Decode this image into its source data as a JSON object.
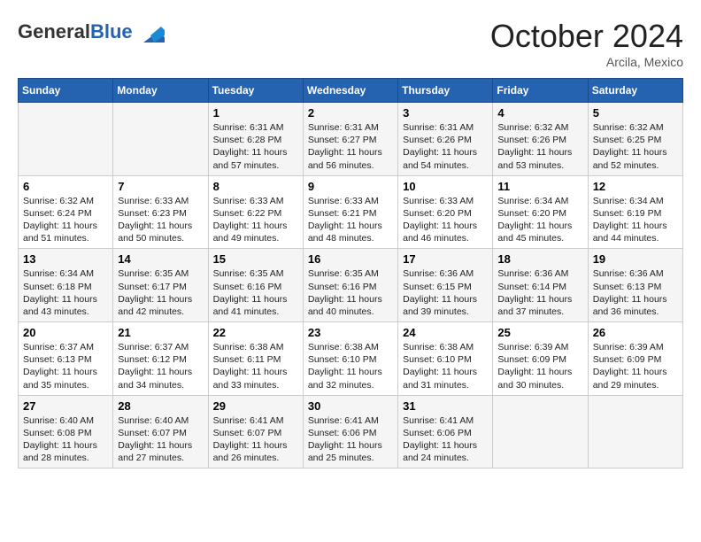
{
  "header": {
    "logo_general": "General",
    "logo_blue": "Blue",
    "month_title": "October 2024",
    "location": "Arcila, Mexico"
  },
  "weekdays": [
    "Sunday",
    "Monday",
    "Tuesday",
    "Wednesday",
    "Thursday",
    "Friday",
    "Saturday"
  ],
  "weeks": [
    [
      {
        "day": "",
        "info": ""
      },
      {
        "day": "",
        "info": ""
      },
      {
        "day": "1",
        "sunrise": "6:31 AM",
        "sunset": "6:28 PM",
        "daylight": "11 hours and 57 minutes."
      },
      {
        "day": "2",
        "sunrise": "6:31 AM",
        "sunset": "6:27 PM",
        "daylight": "11 hours and 56 minutes."
      },
      {
        "day": "3",
        "sunrise": "6:31 AM",
        "sunset": "6:26 PM",
        "daylight": "11 hours and 54 minutes."
      },
      {
        "day": "4",
        "sunrise": "6:32 AM",
        "sunset": "6:26 PM",
        "daylight": "11 hours and 53 minutes."
      },
      {
        "day": "5",
        "sunrise": "6:32 AM",
        "sunset": "6:25 PM",
        "daylight": "11 hours and 52 minutes."
      }
    ],
    [
      {
        "day": "6",
        "sunrise": "6:32 AM",
        "sunset": "6:24 PM",
        "daylight": "11 hours and 51 minutes."
      },
      {
        "day": "7",
        "sunrise": "6:33 AM",
        "sunset": "6:23 PM",
        "daylight": "11 hours and 50 minutes."
      },
      {
        "day": "8",
        "sunrise": "6:33 AM",
        "sunset": "6:22 PM",
        "daylight": "11 hours and 49 minutes."
      },
      {
        "day": "9",
        "sunrise": "6:33 AM",
        "sunset": "6:21 PM",
        "daylight": "11 hours and 48 minutes."
      },
      {
        "day": "10",
        "sunrise": "6:33 AM",
        "sunset": "6:20 PM",
        "daylight": "11 hours and 46 minutes."
      },
      {
        "day": "11",
        "sunrise": "6:34 AM",
        "sunset": "6:20 PM",
        "daylight": "11 hours and 45 minutes."
      },
      {
        "day": "12",
        "sunrise": "6:34 AM",
        "sunset": "6:19 PM",
        "daylight": "11 hours and 44 minutes."
      }
    ],
    [
      {
        "day": "13",
        "sunrise": "6:34 AM",
        "sunset": "6:18 PM",
        "daylight": "11 hours and 43 minutes."
      },
      {
        "day": "14",
        "sunrise": "6:35 AM",
        "sunset": "6:17 PM",
        "daylight": "11 hours and 42 minutes."
      },
      {
        "day": "15",
        "sunrise": "6:35 AM",
        "sunset": "6:16 PM",
        "daylight": "11 hours and 41 minutes."
      },
      {
        "day": "16",
        "sunrise": "6:35 AM",
        "sunset": "6:16 PM",
        "daylight": "11 hours and 40 minutes."
      },
      {
        "day": "17",
        "sunrise": "6:36 AM",
        "sunset": "6:15 PM",
        "daylight": "11 hours and 39 minutes."
      },
      {
        "day": "18",
        "sunrise": "6:36 AM",
        "sunset": "6:14 PM",
        "daylight": "11 hours and 37 minutes."
      },
      {
        "day": "19",
        "sunrise": "6:36 AM",
        "sunset": "6:13 PM",
        "daylight": "11 hours and 36 minutes."
      }
    ],
    [
      {
        "day": "20",
        "sunrise": "6:37 AM",
        "sunset": "6:13 PM",
        "daylight": "11 hours and 35 minutes."
      },
      {
        "day": "21",
        "sunrise": "6:37 AM",
        "sunset": "6:12 PM",
        "daylight": "11 hours and 34 minutes."
      },
      {
        "day": "22",
        "sunrise": "6:38 AM",
        "sunset": "6:11 PM",
        "daylight": "11 hours and 33 minutes."
      },
      {
        "day": "23",
        "sunrise": "6:38 AM",
        "sunset": "6:10 PM",
        "daylight": "11 hours and 32 minutes."
      },
      {
        "day": "24",
        "sunrise": "6:38 AM",
        "sunset": "6:10 PM",
        "daylight": "11 hours and 31 minutes."
      },
      {
        "day": "25",
        "sunrise": "6:39 AM",
        "sunset": "6:09 PM",
        "daylight": "11 hours and 30 minutes."
      },
      {
        "day": "26",
        "sunrise": "6:39 AM",
        "sunset": "6:09 PM",
        "daylight": "11 hours and 29 minutes."
      }
    ],
    [
      {
        "day": "27",
        "sunrise": "6:40 AM",
        "sunset": "6:08 PM",
        "daylight": "11 hours and 28 minutes."
      },
      {
        "day": "28",
        "sunrise": "6:40 AM",
        "sunset": "6:07 PM",
        "daylight": "11 hours and 27 minutes."
      },
      {
        "day": "29",
        "sunrise": "6:41 AM",
        "sunset": "6:07 PM",
        "daylight": "11 hours and 26 minutes."
      },
      {
        "day": "30",
        "sunrise": "6:41 AM",
        "sunset": "6:06 PM",
        "daylight": "11 hours and 25 minutes."
      },
      {
        "day": "31",
        "sunrise": "6:41 AM",
        "sunset": "6:06 PM",
        "daylight": "11 hours and 24 minutes."
      },
      {
        "day": "",
        "info": ""
      },
      {
        "day": "",
        "info": ""
      }
    ]
  ]
}
